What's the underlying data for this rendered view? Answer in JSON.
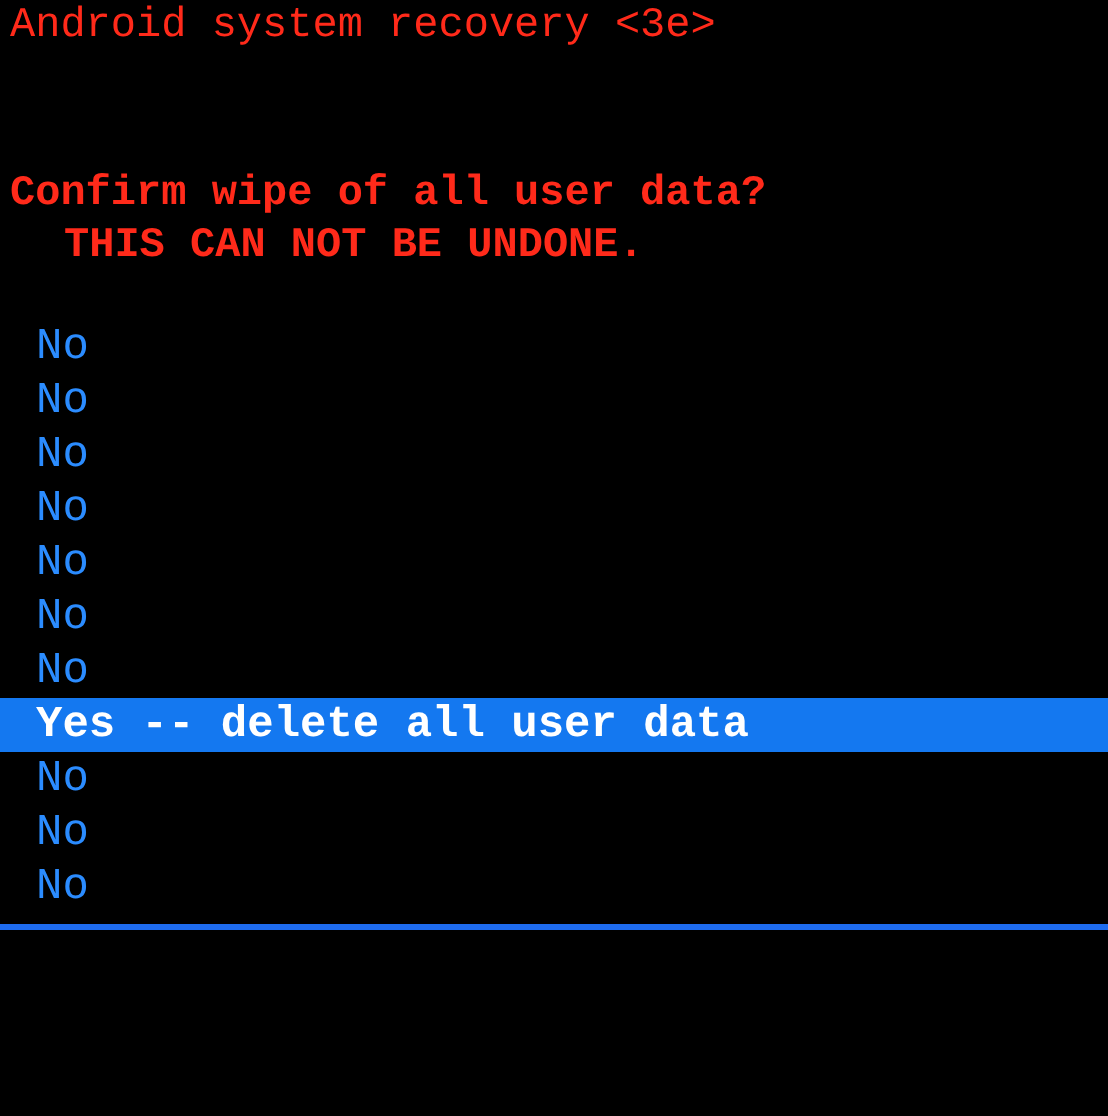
{
  "header": {
    "title": "Android system recovery <3e>"
  },
  "prompt": {
    "question": "Confirm wipe of all user data?",
    "warning": "THIS CAN NOT BE UNDONE."
  },
  "menu": [
    {
      "label": "No",
      "selected": false
    },
    {
      "label": "No",
      "selected": false
    },
    {
      "label": "No",
      "selected": false
    },
    {
      "label": "No",
      "selected": false
    },
    {
      "label": "No",
      "selected": false
    },
    {
      "label": "No",
      "selected": false
    },
    {
      "label": "No",
      "selected": false
    },
    {
      "label": "Yes -- delete all user data",
      "selected": true
    },
    {
      "label": "No",
      "selected": false
    },
    {
      "label": "No",
      "selected": false
    },
    {
      "label": "No",
      "selected": false
    }
  ]
}
